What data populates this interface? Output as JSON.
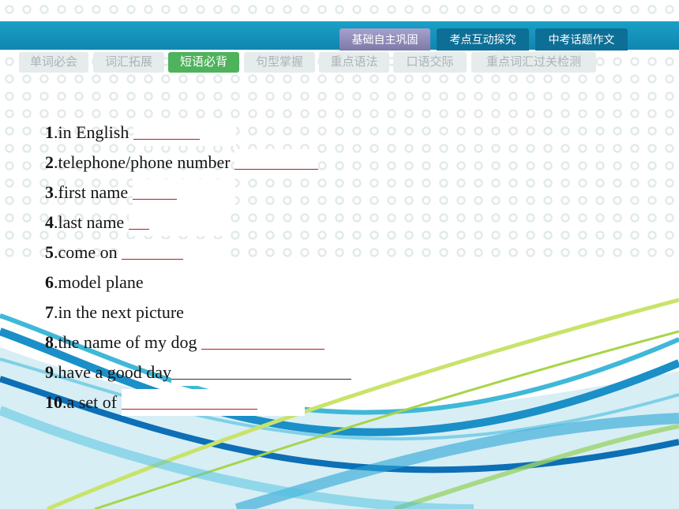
{
  "top_tabs": [
    "基础自主巩固",
    "考点互动探究",
    "中考话题作文"
  ],
  "sub_tabs": [
    "单词必会",
    "词汇拓展",
    "短语必背",
    "句型掌握",
    "重点语法",
    "口语交际",
    "重点词汇过关检测"
  ],
  "active_sub_tab": "短语必背",
  "colors": {
    "top_bar": "#1aa0c6",
    "active_tab": "#4fb25c",
    "blank_line": "#c0161c"
  },
  "items": [
    {
      "num": "1",
      "text": ".in English"
    },
    {
      "num": "2",
      "text": ".telephone/phone number"
    },
    {
      "num": "3",
      "text": ".first name"
    },
    {
      "num": "4",
      "text": ".last name"
    },
    {
      "num": "5",
      "text": ".come on"
    },
    {
      "num": "6",
      "text": ".model plane"
    },
    {
      "num": "7",
      "text": ".in the next picture"
    },
    {
      "num": "8",
      "text": ".the name of my dog"
    },
    {
      "num": "9",
      "text": ".have a good day"
    },
    {
      "num": "10",
      "text": ".a set of"
    }
  ]
}
